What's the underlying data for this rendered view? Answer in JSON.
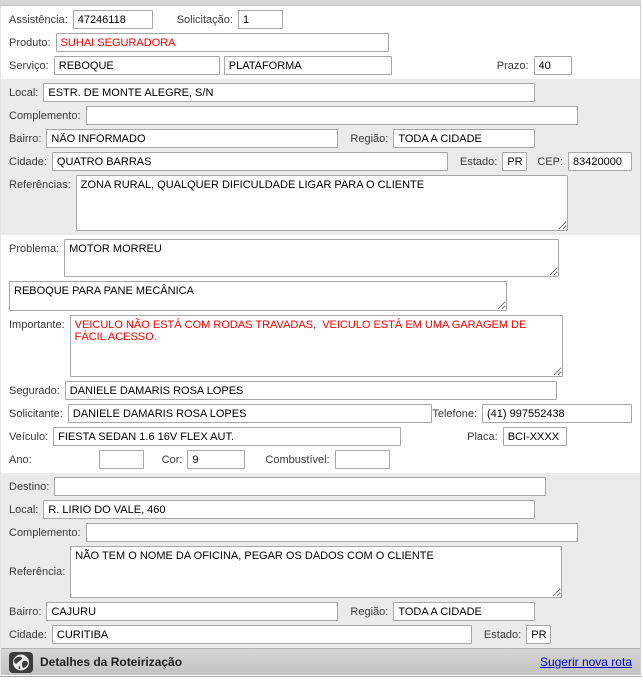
{
  "form": {
    "assistencia": {
      "label": "Assistência:",
      "value": "47246118"
    },
    "solicitacao": {
      "label": "Solicitação:",
      "value": "1"
    },
    "produto": {
      "label": "Produto:",
      "value": "SUHAI SEGURADORA"
    },
    "servico": {
      "label": "Serviço:",
      "value1": "REBOQUE",
      "value2": "PLATAFORMA"
    },
    "prazo": {
      "label": "Prazo:",
      "value": "40"
    },
    "origem": {
      "local": {
        "label": "Local:",
        "value": "ESTR. DE MONTE ALEGRE, S/N"
      },
      "complemento": {
        "label": "Complemento:",
        "value": ""
      },
      "bairro": {
        "label": "Bairro:",
        "value": "NÃO INFORMADO"
      },
      "regiao": {
        "label": "Região:",
        "value": "TODA A CIDADE"
      },
      "cidade": {
        "label": "Cidade:",
        "value": "QUATRO BARRAS"
      },
      "estado": {
        "label": "Estado:",
        "value": "PR"
      },
      "cep": {
        "label": "CEP:",
        "value": "83420000"
      },
      "referencias": {
        "label": "Referências:",
        "value": "ZONA RURAL, QUALQUER DIFICULDADE LIGAR PARA O CLIENTE"
      }
    },
    "ocorrencia": {
      "problema": {
        "label": "Problema:",
        "value": "MOTOR MORREU"
      },
      "problema_complemento": {
        "value": "REBOQUE PARA PANE MECÂNICA"
      },
      "importante": {
        "label": "Importante:",
        "value": "VEICULO NÃO ESTÁ COM RODAS TRAVADAS,  VEICULO ESTÁ EM UMA GARAGEM DE FÁCIL ACESSO."
      },
      "segurado": {
        "label": "Segurado:",
        "value": "DANIELE DAMARIS ROSA LOPES"
      },
      "solicitante": {
        "label": "Solicitante:",
        "value": "DANIELE DAMARIS ROSA LOPES"
      },
      "telefone": {
        "label": "Telefone:",
        "value": "(41) 997552438"
      },
      "veiculo": {
        "label": "Veículo:",
        "value": "FIESTA SEDAN 1.6 16V FLEX AUT."
      },
      "placa": {
        "label": "Placa:",
        "value": "BCI-XXXX"
      },
      "ano": {
        "label": "Ano:",
        "value": ""
      },
      "cor": {
        "label": "Cor:",
        "value": "9"
      },
      "combustivel": {
        "label": "Combustível:",
        "value": ""
      }
    },
    "destino": {
      "destino": {
        "label": "Destino:",
        "value": ""
      },
      "local": {
        "label": "Local:",
        "value": "R. LIRIO DO VALE, 460"
      },
      "complemento": {
        "label": "Complemento:",
        "value": ""
      },
      "referencia": {
        "label": "Referência:",
        "value": "NÃO TEM O NOME DA OFICINA, PEGAR OS DADOS COM O CLIENTE"
      },
      "bairro": {
        "label": "Bairro:",
        "value": "CAJURU"
      },
      "regiao": {
        "label": "Região:",
        "value": "TODA A CIDADE"
      },
      "cidade": {
        "label": "Cidade:",
        "value": "CURITIBA"
      },
      "estado": {
        "label": "Estado:",
        "value": "PR"
      }
    }
  },
  "footer": {
    "title": "Detalhes da Roteirização",
    "link_label": "Sugerir nova rota",
    "icon": "globe-icon"
  },
  "colors": {
    "alert_red": "#FF0000",
    "link_blue": "#0000CC",
    "section_gray": "#EBEBEB",
    "footer_gray": "#C7C7C7"
  }
}
